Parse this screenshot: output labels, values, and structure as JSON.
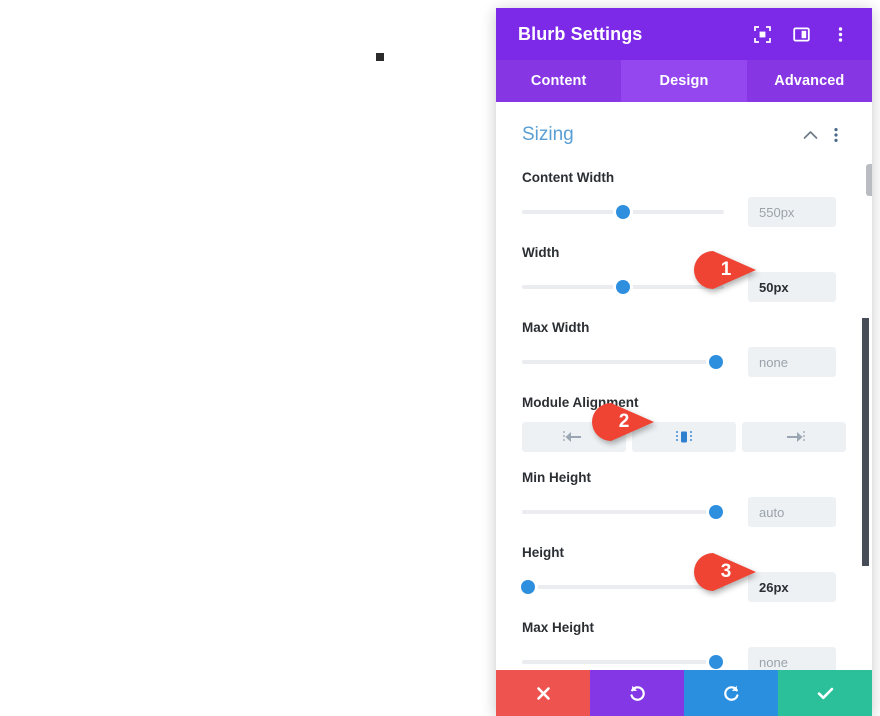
{
  "canvas": {
    "dot_label": "selection-dot"
  },
  "panel": {
    "header": {
      "title": "Blurb Settings",
      "icons": [
        {
          "name": "fullscreen-icon",
          "label": "Expand"
        },
        {
          "name": "layout-toggle-icon",
          "label": "Layout"
        },
        {
          "name": "more-vertical-icon",
          "label": "More"
        }
      ]
    },
    "tabs": [
      {
        "label": "Content",
        "active": false
      },
      {
        "label": "Design",
        "active": true
      },
      {
        "label": "Advanced",
        "active": false
      }
    ],
    "section": {
      "title": "Sizing",
      "collapse_icon": "chevron-up-icon",
      "more_icon": "more-vertical-icon"
    },
    "fields": [
      {
        "label": "Content Width",
        "value": "550px",
        "placeholder": "550px",
        "filled": false,
        "handle_pct": 50
      },
      {
        "label": "Width",
        "value": "50px",
        "placeholder": "50px",
        "filled": true,
        "handle_pct": 50
      },
      {
        "label": "Max Width",
        "value": "none",
        "placeholder": "none",
        "filled": false,
        "handle_pct": 96
      },
      {
        "label": "Min Height",
        "value": "auto",
        "placeholder": "auto",
        "filled": false,
        "handle_pct": 96
      },
      {
        "label": "Height",
        "value": "26px",
        "placeholder": "26px",
        "filled": true,
        "handle_pct": 3
      },
      {
        "label": "Max Height",
        "value": "none",
        "placeholder": "none",
        "filled": false,
        "handle_pct": 96
      }
    ],
    "alignment": {
      "label": "Module Alignment",
      "options": [
        {
          "name": "align-left-icon",
          "label": "Left",
          "active": false
        },
        {
          "name": "align-center-icon",
          "label": "Center",
          "active": true
        },
        {
          "name": "align-right-icon",
          "label": "Right",
          "active": false
        }
      ]
    },
    "actions": [
      {
        "name": "cancel-button",
        "icon": "close-icon",
        "label": "Cancel",
        "color": "#ef5350"
      },
      {
        "name": "undo-button",
        "icon": "undo-icon",
        "label": "Undo",
        "color": "#8337e5"
      },
      {
        "name": "redo-button",
        "icon": "redo-icon",
        "label": "Redo",
        "color": "#2b8fe0"
      },
      {
        "name": "save-button",
        "icon": "checkmark-icon",
        "label": "Save",
        "color": "#2bbf9a"
      }
    ]
  },
  "markers": [
    {
      "number": "1",
      "target": "Width value field"
    },
    {
      "number": "2",
      "target": "Module Alignment center option"
    },
    {
      "number": "3",
      "target": "Height value field"
    }
  ],
  "colors": {
    "header_purple": "#7d2ae8",
    "tab_purple": "#8637e3",
    "tab_active_purple": "#9447ef",
    "section_blue": "#5a9fd4",
    "slider_blue": "#2f8fdf",
    "marker_red": "#ef4434",
    "scrollbar": "#474d57"
  }
}
